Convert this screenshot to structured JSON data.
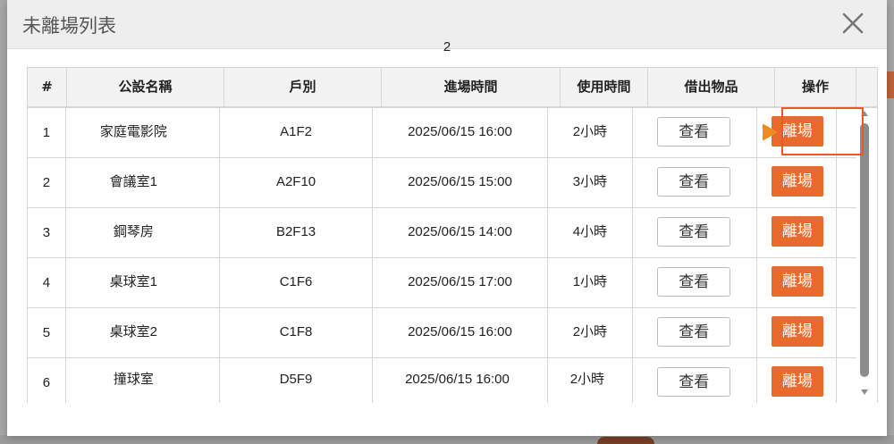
{
  "modal": {
    "title": "未離場列表",
    "page_indicator": "2"
  },
  "table": {
    "headers": [
      "#",
      "公設名稱",
      "戶別",
      "進場時間",
      "使用時間",
      "借出物品",
      "操作"
    ],
    "rows": [
      {
        "no": "1",
        "facility": "家庭電影院",
        "unit": "A1F2",
        "enter_time": "2025/06/15 16:00",
        "duration": "2小時",
        "view_label": "查看",
        "leave_label": "離場"
      },
      {
        "no": "2",
        "facility": "會議室1",
        "unit": "A2F10",
        "enter_time": "2025/06/15 15:00",
        "duration": "3小時",
        "view_label": "查看",
        "leave_label": "離場"
      },
      {
        "no": "3",
        "facility": "鋼琴房",
        "unit": "B2F13",
        "enter_time": "2025/06/15 14:00",
        "duration": "4小時",
        "view_label": "查看",
        "leave_label": "離場"
      },
      {
        "no": "4",
        "facility": "桌球室1",
        "unit": "C1F6",
        "enter_time": "2025/06/15 17:00",
        "duration": "1小時",
        "view_label": "查看",
        "leave_label": "離場"
      },
      {
        "no": "5",
        "facility": "桌球室2",
        "unit": "C1F8",
        "enter_time": "2025/06/15 16:00",
        "duration": "2小時",
        "view_label": "查看",
        "leave_label": "離場"
      },
      {
        "no": "6",
        "facility": "撞球室",
        "unit": "D5F9",
        "enter_time": "2025/06/15 16:00",
        "duration": "2小時",
        "view_label": "查看",
        "leave_label": "離場"
      }
    ]
  },
  "icons": {
    "close": "close-icon",
    "pointer": "pointer-arrow-icon",
    "scroll_up": "chevron-up-icon",
    "scroll_down": "chevron-down-icon"
  },
  "colors": {
    "accent": "#ea6a2e",
    "highlight": "#e9572b",
    "pointer": "#f08c1e"
  }
}
